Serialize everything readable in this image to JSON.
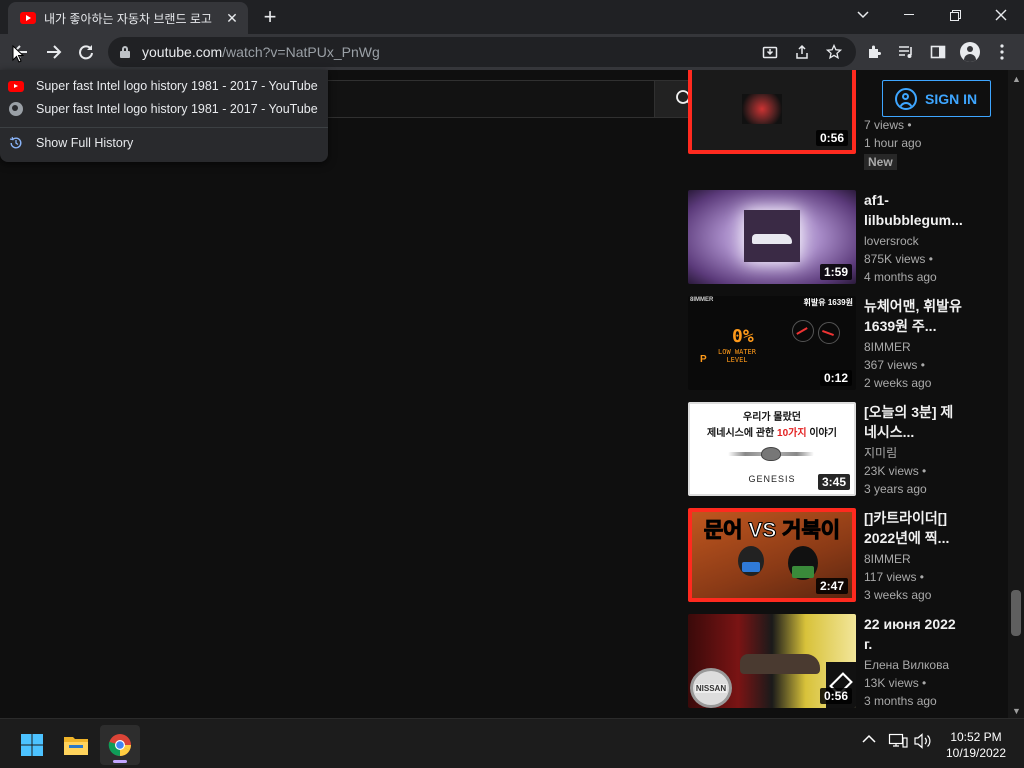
{
  "browser": {
    "tab": {
      "title": "내가 좋아하는 자동차 브랜드 로고"
    },
    "window_controls": {
      "dropdown": "⌄",
      "minimize": "—",
      "restore": "❐",
      "close": "✕"
    },
    "url": {
      "domain": "youtube.com",
      "path": "/watch?v=NatPUx_PnWg"
    }
  },
  "history_menu": {
    "items": [
      {
        "label": "Super fast Intel logo history 1981 - 2017 - YouTube",
        "icon": "youtube-favicon"
      },
      {
        "label": "Super fast Intel logo history 1981 - 2017 - YouTube",
        "icon": "globe-icon"
      }
    ],
    "show_full": "Show Full History"
  },
  "youtube": {
    "signin": "SIGN IN",
    "videos": [
      {
        "title": "",
        "channel": "",
        "views": "7 views •",
        "age": "1 hour ago",
        "badge": "New",
        "duration": "0:56"
      },
      {
        "title": "af1-lilbubblegum...",
        "channel": "loversrock",
        "views": "875K views •",
        "age": "4 months ago",
        "duration": "1:59"
      },
      {
        "title": "뉴체어맨, 휘발유 1639원 주...",
        "channel": "8IMMER",
        "views": "367 views •",
        "age": "2 weeks ago",
        "duration": "0:12",
        "thumb_text": {
          "corner_left": "8IMMER",
          "corner_right": "휘발유 1639원",
          "dash": "LOW WATER LEVEL",
          "gauge": "0%",
          "gear": "P"
        }
      },
      {
        "title": "[오늘의 3분] 제네시스...",
        "channel": "지미림",
        "views": "23K views •",
        "age": "3 years ago",
        "duration": "3:45",
        "thumb_text": {
          "line1": "우리가 몰랐던",
          "line2_a": "제네시스에 관한 ",
          "line2_b": "10가지",
          "line2_c": " 이야기",
          "brand": "GENESIS"
        }
      },
      {
        "title": "[]카트라이더[] 2022년에 찍...",
        "channel": "8IMMER",
        "views": "117 views •",
        "age": "3 weeks ago",
        "duration": "2:47",
        "thumb_text": {
          "headline": "문어 VS 거북이"
        }
      },
      {
        "title": "22 июня 2022 г.",
        "channel": "Елена Вилкова",
        "views": "13K views •",
        "age": "3 months ago",
        "duration": "0:56",
        "thumb_text": {
          "brand": "NISSAN"
        }
      }
    ]
  },
  "taskbar": {
    "tray_chevron": "^",
    "time": "10:52 PM",
    "date": "10/19/2022"
  },
  "colors": {
    "youtube_red": "#ff0000",
    "signin_blue": "#3ea6ff",
    "chrome_dark": "#202124",
    "toolbar": "#35363a"
  }
}
